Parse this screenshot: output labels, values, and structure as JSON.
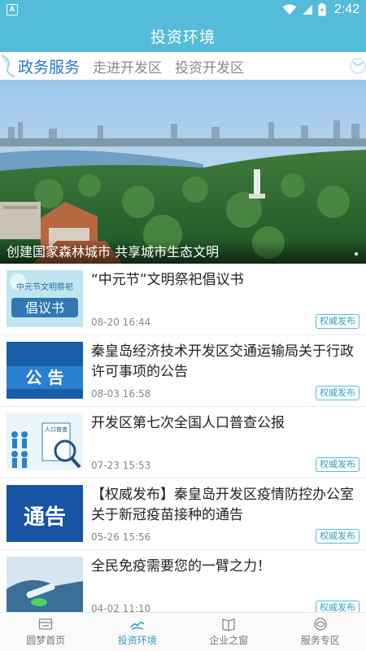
{
  "status_bar": {
    "notification_letter": "A",
    "time": "2:42"
  },
  "app_bar": {
    "title": "投资环境"
  },
  "tabs": [
    {
      "label": "政务服务",
      "active": true
    },
    {
      "label": "走进开发区",
      "active": false
    },
    {
      "label": "投资开发区",
      "active": false
    }
  ],
  "banner": {
    "caption": "创建国家森林城市 共享城市生态文明"
  },
  "news": [
    {
      "title": "“中元节”文明祭祀倡议书",
      "date": "08-20 16:44",
      "tag": "权威发布",
      "thumb_text_top": "中元节文明祭祀",
      "thumb_text_main": "倡议书"
    },
    {
      "title": "秦皇岛经济技术开发区交通运输局关于行政许可事项的公告",
      "date": "08-03 16:58",
      "tag": "权威发布",
      "thumb_text_main": "公 告"
    },
    {
      "title": "开发区第七次全国人口普查公报",
      "date": "07-23 15:53",
      "tag": "权威发布",
      "thumb_text_top": "人口普查"
    },
    {
      "title": "【权威发布】秦皇岛开发区疫情防控办公室关于新冠疫苗接种的通告",
      "date": "05-26 15:56",
      "tag": "权威发布",
      "thumb_text_main": "通告"
    },
    {
      "title": "全民免疫需要您的一臂之力！",
      "date": "04-02 11:10",
      "tag": "权威发布"
    }
  ],
  "bottom_nav": [
    {
      "label": "圆梦首页",
      "icon": "home-icon",
      "active": false
    },
    {
      "label": "投资环境",
      "icon": "investment-icon",
      "active": true
    },
    {
      "label": "企业之窗",
      "icon": "book-icon",
      "active": false
    },
    {
      "label": "服务专区",
      "icon": "service-icon",
      "active": false
    }
  ],
  "colors": {
    "primary": "#54bcd8",
    "active_tab": "#2b78c5",
    "tag": "#2f9fc4"
  }
}
